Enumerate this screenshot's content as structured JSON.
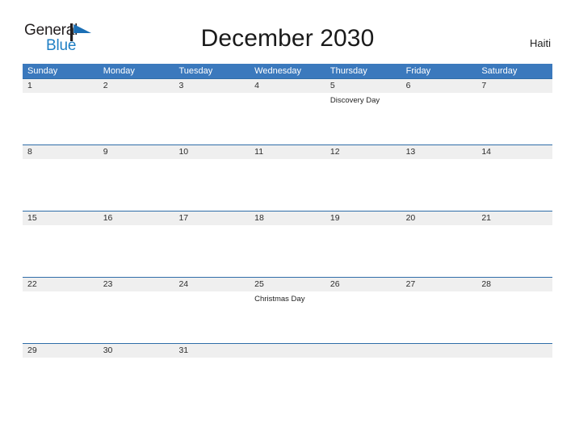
{
  "brand": {
    "name_line1": "General",
    "name_line2": "Blue",
    "flag_icon": "blue-flag-triangle",
    "color_dark": "#231f20",
    "color_blue": "#1f7fc4"
  },
  "header": {
    "title": "December 2030",
    "region": "Haiti"
  },
  "theme": {
    "header_blue": "#3b79bd",
    "row_line_blue": "#2f6da8",
    "date_band_gray": "#efefef",
    "page_background": "#ffffff",
    "text_dark": "#2b2b2b"
  },
  "calendar": {
    "month": "December",
    "year": "2030",
    "weekdays": [
      "Sunday",
      "Monday",
      "Tuesday",
      "Wednesday",
      "Thursday",
      "Friday",
      "Saturday"
    ],
    "weeks": [
      [
        {
          "date": "1",
          "event": ""
        },
        {
          "date": "2",
          "event": ""
        },
        {
          "date": "3",
          "event": ""
        },
        {
          "date": "4",
          "event": ""
        },
        {
          "date": "5",
          "event": "Discovery Day"
        },
        {
          "date": "6",
          "event": ""
        },
        {
          "date": "7",
          "event": ""
        }
      ],
      [
        {
          "date": "8",
          "event": ""
        },
        {
          "date": "9",
          "event": ""
        },
        {
          "date": "10",
          "event": ""
        },
        {
          "date": "11",
          "event": ""
        },
        {
          "date": "12",
          "event": ""
        },
        {
          "date": "13",
          "event": ""
        },
        {
          "date": "14",
          "event": ""
        }
      ],
      [
        {
          "date": "15",
          "event": ""
        },
        {
          "date": "16",
          "event": ""
        },
        {
          "date": "17",
          "event": ""
        },
        {
          "date": "18",
          "event": ""
        },
        {
          "date": "19",
          "event": ""
        },
        {
          "date": "20",
          "event": ""
        },
        {
          "date": "21",
          "event": ""
        }
      ],
      [
        {
          "date": "22",
          "event": ""
        },
        {
          "date": "23",
          "event": ""
        },
        {
          "date": "24",
          "event": ""
        },
        {
          "date": "25",
          "event": "Christmas Day"
        },
        {
          "date": "26",
          "event": ""
        },
        {
          "date": "27",
          "event": ""
        },
        {
          "date": "28",
          "event": ""
        }
      ],
      [
        {
          "date": "29",
          "event": ""
        },
        {
          "date": "30",
          "event": ""
        },
        {
          "date": "31",
          "event": ""
        },
        {
          "date": "",
          "event": ""
        },
        {
          "date": "",
          "event": ""
        },
        {
          "date": "",
          "event": ""
        },
        {
          "date": "",
          "event": ""
        }
      ]
    ],
    "holidays": [
      {
        "date": "5",
        "name": "Discovery Day"
      },
      {
        "date": "25",
        "name": "Christmas Day"
      }
    ]
  }
}
